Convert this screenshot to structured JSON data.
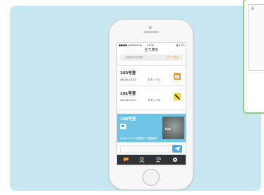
{
  "phone_screen": {
    "statusbar": {
      "carrier": "●●●● Softbank ◈",
      "time": "14:00",
      "battery": "▮ 47%"
    },
    "nav_title": "全て表示",
    "search": {
      "placeholder": "部屋番号を検索",
      "action": "すべて見る"
    },
    "rows": [
      {
        "title": "103号室",
        "time": "06/18 13:25",
        "staff": "スタッフA",
        "thumb_color": "#f29a2c"
      },
      {
        "title": "101号室",
        "time": "06/18 13:57",
        "staff": "スタッフB",
        "thumb_color": "#f4d23a"
      }
    ],
    "highlighted_row": {
      "title": "108号室",
      "meta": "06/18 14:03 清掃完了 部屋番号",
      "photo_label": "tub",
      "background": "#6ec4e4"
    },
    "tabs": [
      "chat-icon",
      "person-icon",
      "users-icon",
      "gear-icon"
    ],
    "accent": "#4fa8d8"
  },
  "panel": {
    "background": "#c8e7ee"
  },
  "side_card": {
    "label": "A"
  }
}
